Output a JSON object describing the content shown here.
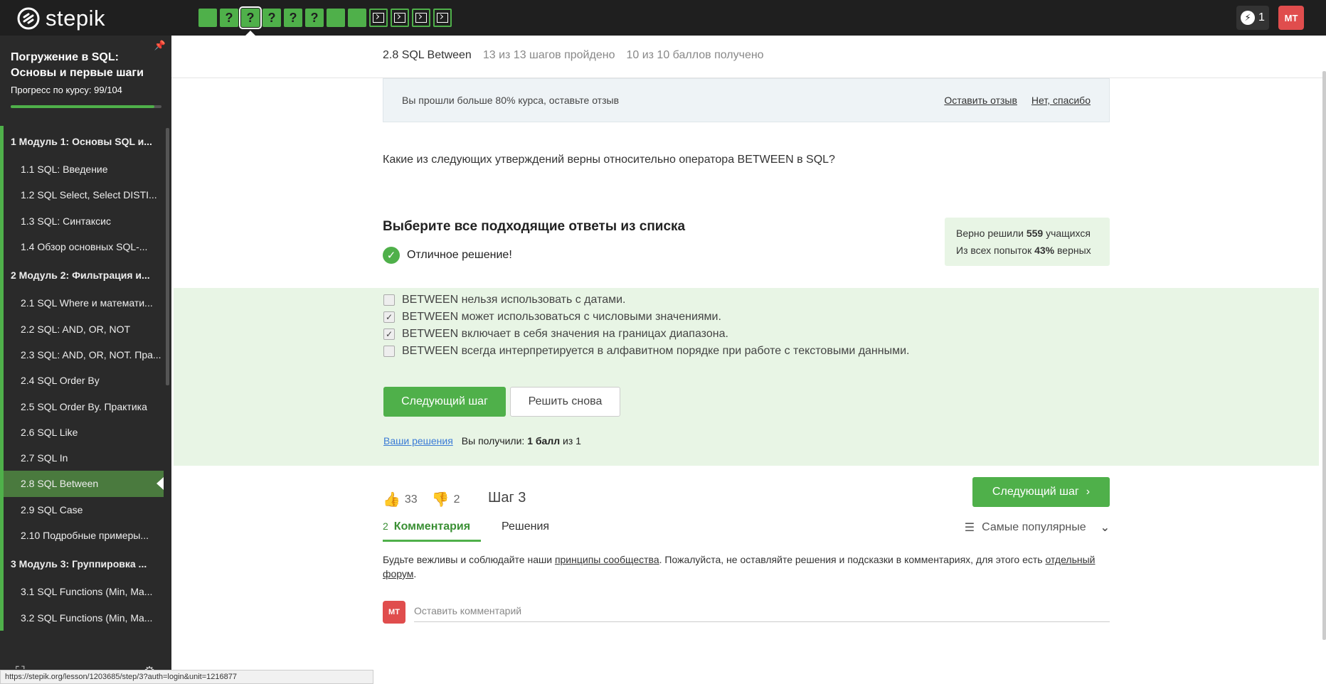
{
  "topbar": {
    "logo_text": "stepik",
    "steps": [
      {
        "type": "done"
      },
      {
        "type": "quiz",
        "label": "?"
      },
      {
        "type": "quiz",
        "label": "?",
        "current": true
      },
      {
        "type": "quiz",
        "label": "?"
      },
      {
        "type": "quiz",
        "label": "?"
      },
      {
        "type": "quiz",
        "label": "?"
      },
      {
        "type": "done"
      },
      {
        "type": "done"
      },
      {
        "type": "code"
      },
      {
        "type": "code"
      },
      {
        "type": "code"
      },
      {
        "type": "code"
      }
    ],
    "energy_count": "1",
    "avatar_initials": "MT"
  },
  "sidebar": {
    "course_title": "Погружение в SQL: Основы и первые шаги",
    "progress_label": "Прогресс по курсу:  99/104",
    "progress": 0.952,
    "items": [
      {
        "kind": "module",
        "label": "1  Модуль 1: Основы SQL и..."
      },
      {
        "kind": "lesson",
        "label": "1.1  SQL: Введение"
      },
      {
        "kind": "lesson",
        "label": "1.2  SQL Select, Select DISTI..."
      },
      {
        "kind": "lesson",
        "label": "1.3  SQL: Синтаксис"
      },
      {
        "kind": "lesson",
        "label": "1.4  Обзор основных SQL-..."
      },
      {
        "kind": "module",
        "label": "2  Модуль 2: Фильтрация и..."
      },
      {
        "kind": "lesson",
        "label": "2.1  SQL Where и математи..."
      },
      {
        "kind": "lesson",
        "label": "2.2  SQL: AND, OR, NOT"
      },
      {
        "kind": "lesson",
        "label": "2.3  SQL: AND, OR, NOT. Пра..."
      },
      {
        "kind": "lesson",
        "label": "2.4  SQL Order By"
      },
      {
        "kind": "lesson",
        "label": "2.5  SQL Order By. Практика"
      },
      {
        "kind": "lesson",
        "label": "2.6  SQL Like"
      },
      {
        "kind": "lesson",
        "label": "2.7  SQL In"
      },
      {
        "kind": "lesson",
        "label": "2.8  SQL Between",
        "active": true
      },
      {
        "kind": "lesson",
        "label": "2.9  SQL Case"
      },
      {
        "kind": "lesson",
        "label": "2.10  Подробные примеры..."
      },
      {
        "kind": "module",
        "label": "3  Модуль 3: Группировка ..."
      },
      {
        "kind": "lesson",
        "label": "3.1  SQL Functions (Min, Ma..."
      },
      {
        "kind": "lesson",
        "label": "3.2  SQL Functions (Min, Ma..."
      }
    ]
  },
  "lesson": {
    "title": "2.8 SQL Between",
    "steps_done": "13 из 13 шагов пройдено",
    "points": "10 из 10 баллов  получено"
  },
  "review": {
    "text": "Вы прошли больше 80% курса, оставьте отзыв",
    "leave": "Оставить отзыв",
    "decline": "Нет, спасибо"
  },
  "question": "Какие из следующих утверждений верны относительно оператора BETWEEN в SQL?",
  "choose_title": "Выберите все подходящие ответы из списка",
  "result_text": "Отличное решение!",
  "stats": {
    "line1_pre": "Верно решили ",
    "line1_num": "559",
    "line1_post": " учащихся",
    "line2_pre": "Из всех попыток ",
    "line2_num": "43%",
    "line2_post": " верных"
  },
  "options": [
    {
      "text": "BETWEEN нельзя использовать с датами.",
      "checked": false
    },
    {
      "text": "BETWEEN может использоваться с числовыми значениями.",
      "checked": true
    },
    {
      "text": "BETWEEN включает в себя значения на границах диапазона.",
      "checked": true
    },
    {
      "text": "BETWEEN всегда интерпретируется в алфавитном порядке при работе с текстовыми данными.",
      "checked": false
    }
  ],
  "buttons": {
    "next_step": "Следующий шаг",
    "retry": "Решить снова"
  },
  "solutions": {
    "link": "Ваши решения",
    "got_pre": "Вы получили: ",
    "got_bold": "1 балл",
    "got_post": " из 1"
  },
  "footer": {
    "likes": "33",
    "dislikes": "2",
    "step_label": "Шаг 3",
    "next_step": "Следующий шаг"
  },
  "comments": {
    "count": "2",
    "tab_comments": "Комментария",
    "tab_solutions": "Решения",
    "sort_label": "Самые популярные",
    "rules_pre": "Будьте вежливы и соблюдайте наши ",
    "rules_link1": "принципы сообщества",
    "rules_mid": ". Пожалуйста, не оставляйте решения и подсказки в комментариях, для этого есть ",
    "rules_link2": "отдельный форум",
    "rules_end": ".",
    "avatar_initials": "MT",
    "input_placeholder": "Оставить комментарий"
  },
  "status_url": "https://stepik.org/lesson/1203685/step/3?auth=login&unit=1216877",
  "colors": {
    "accent": "#4fb04a",
    "topbar": "#1f1f1f",
    "sidebar": "#2a2a2a",
    "avatar": "#e04d4d",
    "correct_bg": "#e8f5e5"
  }
}
